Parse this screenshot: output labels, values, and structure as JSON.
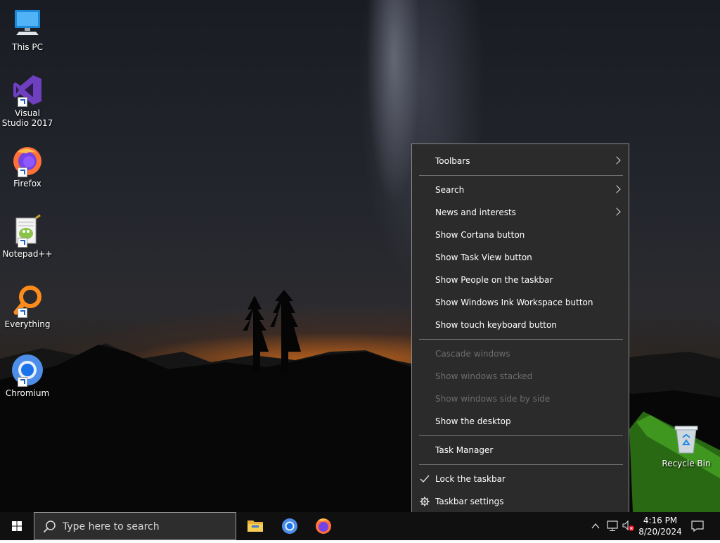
{
  "desktop": {
    "icons": [
      {
        "label": "This PC",
        "icon": "computer-icon"
      },
      {
        "label": "Visual Studio 2017",
        "icon": "visual-studio-icon"
      },
      {
        "label": "Firefox",
        "icon": "firefox-icon"
      },
      {
        "label": "Notepad++",
        "icon": "notepadpp-icon"
      },
      {
        "label": "Everything",
        "icon": "everything-search-icon"
      },
      {
        "label": "Chromium",
        "icon": "chromium-icon"
      }
    ],
    "recycle_bin": {
      "label": "Recycle Bin",
      "icon": "recycle-bin-icon"
    }
  },
  "context_menu": {
    "items": [
      {
        "label": "Toolbars",
        "submenu": true,
        "enabled": true
      },
      {
        "label": "Search",
        "submenu": true,
        "enabled": true
      },
      {
        "label": "News and interests",
        "submenu": true,
        "enabled": true
      },
      {
        "label": "Show Cortana button",
        "enabled": true
      },
      {
        "label": "Show Task View button",
        "enabled": true
      },
      {
        "label": "Show People on the taskbar",
        "enabled": true
      },
      {
        "label": "Show Windows Ink Workspace button",
        "enabled": true
      },
      {
        "label": "Show touch keyboard button",
        "enabled": true
      },
      {
        "label": "Cascade windows",
        "enabled": false
      },
      {
        "label": "Show windows stacked",
        "enabled": false
      },
      {
        "label": "Show windows side by side",
        "enabled": false
      },
      {
        "label": "Show the desktop",
        "enabled": true
      },
      {
        "label": "Task Manager",
        "enabled": true
      },
      {
        "label": "Lock the taskbar",
        "enabled": true,
        "checked": true
      },
      {
        "label": "Taskbar settings",
        "enabled": true,
        "icon": "gear-icon"
      }
    ]
  },
  "taskbar": {
    "search_placeholder": "Type here to search",
    "pinned_apps": [
      "file-explorer-icon",
      "chromium-icon",
      "firefox-icon"
    ],
    "tray_icons": [
      "chevron-up-icon",
      "network-icon",
      "volume-muted-icon"
    ],
    "time": "4:16 PM",
    "date": "8/20/2024",
    "notification_icon": "action-center-icon"
  },
  "colors": {
    "menu_bg": "#2b2b2b",
    "menu_border": "#8a8a8a",
    "menu_disabled_text": "#6d6d6d",
    "taskbar_bg": "#101010"
  }
}
